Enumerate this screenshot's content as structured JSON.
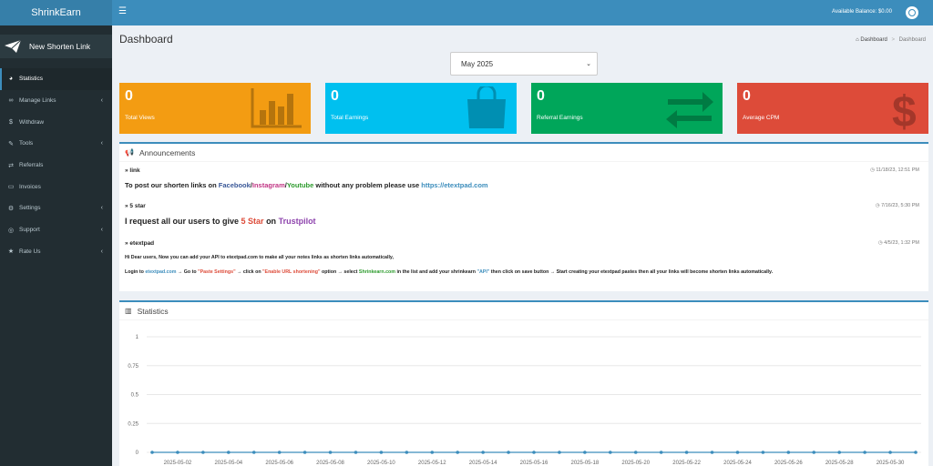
{
  "app": {
    "logo": "ShrinkEarn",
    "balance": "Available Balance: $0.00"
  },
  "sidebar": {
    "new_link": "New Shorten Link",
    "items": [
      {
        "label": "Statistics",
        "icon": "dashboard-icon",
        "active": true,
        "has_children": false
      },
      {
        "label": "Manage Links",
        "icon": "link-icon",
        "active": false,
        "has_children": true
      },
      {
        "label": "Withdraw",
        "icon": "dollar-icon",
        "active": false,
        "has_children": false
      },
      {
        "label": "Tools",
        "icon": "wrench-icon",
        "active": false,
        "has_children": true
      },
      {
        "label": "Referrals",
        "icon": "exchange-icon",
        "active": false,
        "has_children": false
      },
      {
        "label": "Invoices",
        "icon": "credit-card-icon",
        "active": false,
        "has_children": false
      },
      {
        "label": "Settings",
        "icon": "cogs-icon",
        "active": false,
        "has_children": true
      },
      {
        "label": "Support",
        "icon": "lifebuoy-icon",
        "active": false,
        "has_children": true
      },
      {
        "label": "Rate Us",
        "icon": "star-icon",
        "active": false,
        "has_children": true
      }
    ]
  },
  "header": {
    "title": "Dashboard",
    "breadcrumb_home": "Dashboard",
    "breadcrumb_current": "Dashboard"
  },
  "month": {
    "selected": "May 2025"
  },
  "tiles": [
    {
      "value": "0",
      "label": "Total Views",
      "color": "#f39c12",
      "icon": "bar-chart-icon"
    },
    {
      "value": "0",
      "label": "Total Earnings",
      "color": "#00c0ef",
      "icon": "shopping-bag-icon"
    },
    {
      "value": "0",
      "label": "Referral Earnings",
      "color": "#00a65a",
      "icon": "exchange-icon"
    },
    {
      "value": "0",
      "label": "Average CPM",
      "color": "#dd4b39",
      "icon": "dollar-icon"
    }
  ],
  "announcements": {
    "title": "Announcements",
    "items": [
      {
        "title": "link",
        "time": "11/18/23, 12:51 PM",
        "body": {
          "pre": "To post our shorten links on ",
          "facebook": "Facebook",
          "sep1": "/",
          "instagram": "Instagram",
          "sep2": "/",
          "youtube": "Youtube",
          "mid": " without any problem please use ",
          "url": "https://etextpad.com"
        }
      },
      {
        "title": "5 star",
        "time": "7/16/23, 5:30 PM",
        "body": {
          "pre": "I request all our users to give ",
          "star": "5 Star",
          "mid": " on ",
          "trustpilot": "Trustpilot"
        }
      },
      {
        "title": "etextpad",
        "time": "4/5/23, 1:32 PM",
        "line1": "Hi Dear users, Now you can add your API to etextpad.com to make all your notes links as shorten links automatically,",
        "line2": {
          "a": "Login to ",
          "site": "etextpad.com",
          "b": " → Go to ",
          "paste": "\"Paste Settings\"",
          "c": " → click on ",
          "enable": "\"Enable URL shortening\"",
          "d": " option → select ",
          "shrink": "Shrinkearn.com",
          "e": " in the list and add your shrinkearn ",
          "api": "\"API\"",
          "f": " then click on save button → Start creating your etextpad pastes then all your links will become shorten links automatically."
        }
      }
    ]
  },
  "statistics": {
    "title": "Statistics"
  },
  "chart_data": {
    "type": "line",
    "ylim": [
      0,
      1
    ],
    "y_ticks": [
      "0",
      "0.25",
      "0.5",
      "0.75",
      "1"
    ],
    "x_tick_labels": [
      "2025-05-02",
      "2025-05-04",
      "2025-05-06",
      "2025-05-08",
      "2025-05-10",
      "2025-05-12",
      "2025-05-14",
      "2025-05-16",
      "2025-05-18",
      "2025-05-20",
      "2025-05-22",
      "2025-05-24",
      "2025-05-26",
      "2025-05-28",
      "2025-05-30"
    ],
    "x": [
      "2025-05-01",
      "2025-05-02",
      "2025-05-03",
      "2025-05-04",
      "2025-05-05",
      "2025-05-06",
      "2025-05-07",
      "2025-05-08",
      "2025-05-09",
      "2025-05-10",
      "2025-05-11",
      "2025-05-12",
      "2025-05-13",
      "2025-05-14",
      "2025-05-15",
      "2025-05-16",
      "2025-05-17",
      "2025-05-18",
      "2025-05-19",
      "2025-05-20",
      "2025-05-21",
      "2025-05-22",
      "2025-05-23",
      "2025-05-24",
      "2025-05-25",
      "2025-05-26",
      "2025-05-27",
      "2025-05-28",
      "2025-05-29",
      "2025-05-30",
      "2025-05-31"
    ],
    "series": [
      {
        "values": [
          0,
          0,
          0,
          0,
          0,
          0,
          0,
          0,
          0,
          0,
          0,
          0,
          0,
          0,
          0,
          0,
          0,
          0,
          0,
          0,
          0,
          0,
          0,
          0,
          0,
          0,
          0,
          0,
          0,
          0,
          0
        ]
      }
    ],
    "line_color": "#3c8dbc",
    "grid": true
  }
}
